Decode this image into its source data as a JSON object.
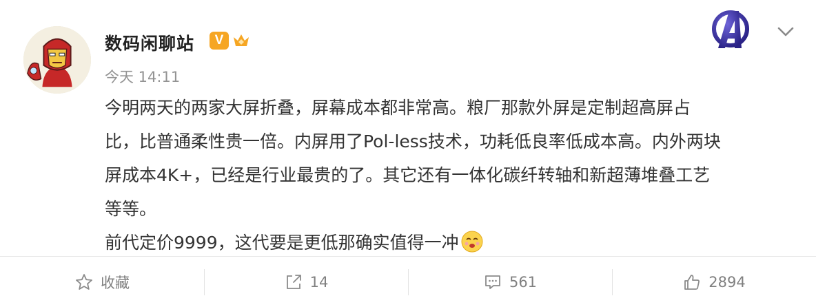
{
  "post": {
    "username": "数码闲聊站",
    "verified_badge": "V",
    "timestamp": "今天 14:11",
    "lines": [
      "今明两天的两家大屏折叠，屏幕成本都非常高。粮厂那款外屏是定制超高屏占",
      "比，比普通柔性贵一倍。内屏用了Pol-less技术，功耗低良率低成本高。内外两块",
      "屏成本4K+，已经是行业最贵的了。其它还有一体化碳纤转轴和新超薄堆叠工艺",
      "等等。",
      "前代定价9999，这代要是更低那确实值得一冲"
    ]
  },
  "actions": {
    "favorite_label": "收藏",
    "repost_count": "14",
    "comment_count": "561",
    "like_count": "2894"
  },
  "icons": [
    "avatar",
    "verified-badge",
    "member-crown-icon",
    "avengers-logo",
    "chevron-down-icon",
    "emoji-icon",
    "star-icon",
    "share-icon",
    "comment-icon",
    "thumbs-up-icon"
  ],
  "colors": {
    "badge": "#f6a623",
    "muted_text": "#939393",
    "body_text": "#333333"
  }
}
